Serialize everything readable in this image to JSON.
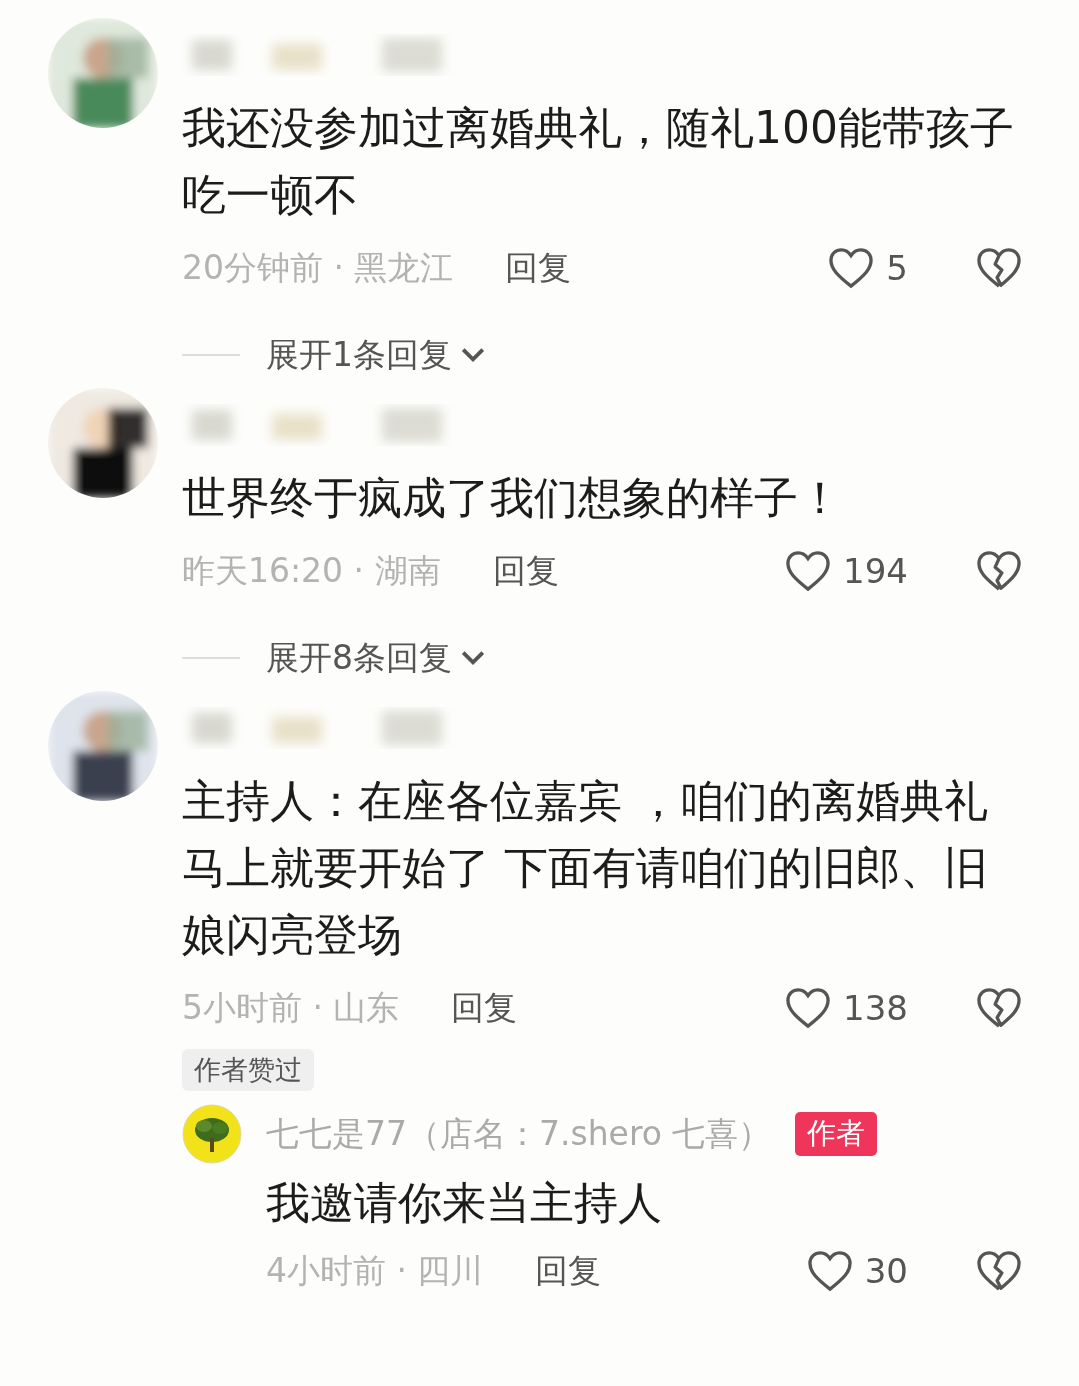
{
  "comments": [
    {
      "text": "我还没参加过离婚典礼，随礼100能带孩子吃一顿不",
      "meta": "20分钟前 · 黑龙江",
      "reply_label": "回复",
      "likes": "5",
      "liked": false,
      "expand": "展开1条回复"
    },
    {
      "text": "世界终于疯成了我们想象的样子！",
      "meta": "昨天16:20 · 湖南",
      "reply_label": "回复",
      "likes": "194",
      "liked": false,
      "expand": "展开8条回复"
    },
    {
      "text": "主持人：在座各位嘉宾 ，咱们的离婚典礼马上就要开始了 下面有请咱们的旧郎、旧娘闪亮登场",
      "meta": "5小时前 · 山东",
      "reply_label": "回复",
      "likes": "138",
      "liked": false,
      "author_liked": "作者赞过",
      "replies": [
        {
          "name": "七七是77（店名：7.shero 七喜）",
          "badge": "作者",
          "text": "我邀请你来当主持人",
          "meta": "4小时前 · 四川",
          "reply_label": "回复",
          "likes": "30",
          "liked": false
        }
      ]
    }
  ]
}
